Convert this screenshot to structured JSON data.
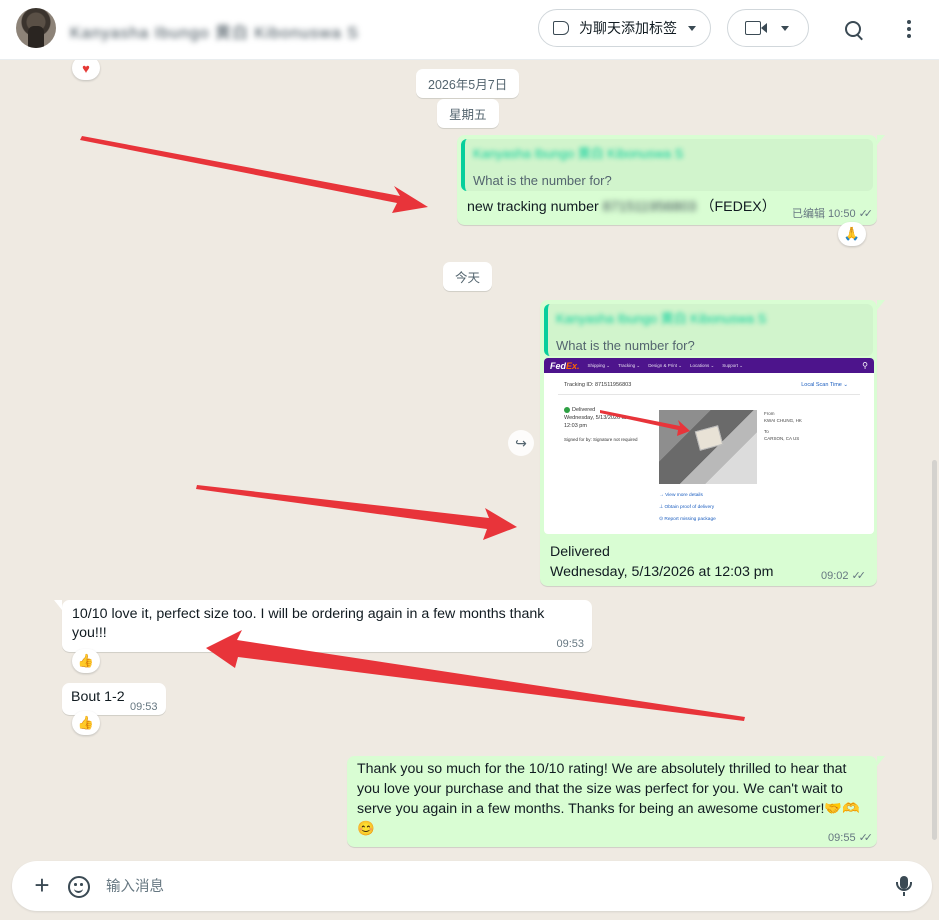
{
  "header": {
    "contact_name": "Kanyasha Ibungo 黄白 Kibonuswa S",
    "label_button": "为聊天添加标签",
    "icons": [
      "video-camera-icon",
      "search-icon",
      "menu-icon"
    ]
  },
  "chat": {
    "top_reaction": "♥",
    "date_1": "2026年5月7日",
    "weekday": "星期五",
    "msg1": {
      "quote_author": "Kanyasha Ibungo 黄白 Kibonuswa S",
      "quote_text": "What is the number for?",
      "text": "new tracking number",
      "tracking_blur": "871511956803",
      "carrier": "（FEDEX）",
      "edited": "已编辑",
      "time": "10:50",
      "reaction": "🙏"
    },
    "date_today": "今天",
    "msg2": {
      "quote_author": "Kanyasha Ibungo 黄白 Kibonuswa S",
      "quote_text": "What is the number for?",
      "fedex": {
        "logo_fed": "Fed",
        "logo_ex": "Ex.",
        "nav": [
          "Shipping ⌄",
          "Tracking ⌄",
          "Design & Print ⌄",
          "Locations ⌄",
          "Support ⌄"
        ],
        "tracking_id": "Tracking ID: 871511956803",
        "local_time": "Local Scan Time ⌄",
        "status": "Delivered",
        "status_date": "Wednesday, 5/13/2026 at",
        "status_time": "12:03 pm",
        "signed": "Signed for by: Signature not required",
        "from_label": "From",
        "from_value": "KWAI CHUNG, HK",
        "to_label": "To",
        "to_value": "CARSON, CA US",
        "link_1": "→ View more details",
        "link_2": "⊥ Obtain proof of delivery",
        "link_3": "⊙ Report missing package"
      },
      "line1": "Delivered",
      "line2": "Wednesday, 5/13/2026 at 12:03 pm",
      "time": "09:02"
    },
    "msg3": {
      "text": "10/10 love it, perfect size too. I will be ordering again in a few months thank you!!!",
      "time": "09:53",
      "reaction": "👍"
    },
    "msg4": {
      "text": "Bout 1-2",
      "time": "09:53",
      "reaction": "👍"
    },
    "msg5": {
      "text": "Thank you so much for the 10/10 rating! We are absolutely thrilled to hear that you love your purchase and that the size was perfect for you. We can't wait to serve you again in a few months. Thanks for being an awesome customer!🤝🫶😊",
      "time": "09:55"
    },
    "ticks": "✓✓",
    "forward_icon": "↪",
    "annotation_color": "#e8343a"
  },
  "composer": {
    "plus": "+",
    "placeholder": "输入消息"
  }
}
